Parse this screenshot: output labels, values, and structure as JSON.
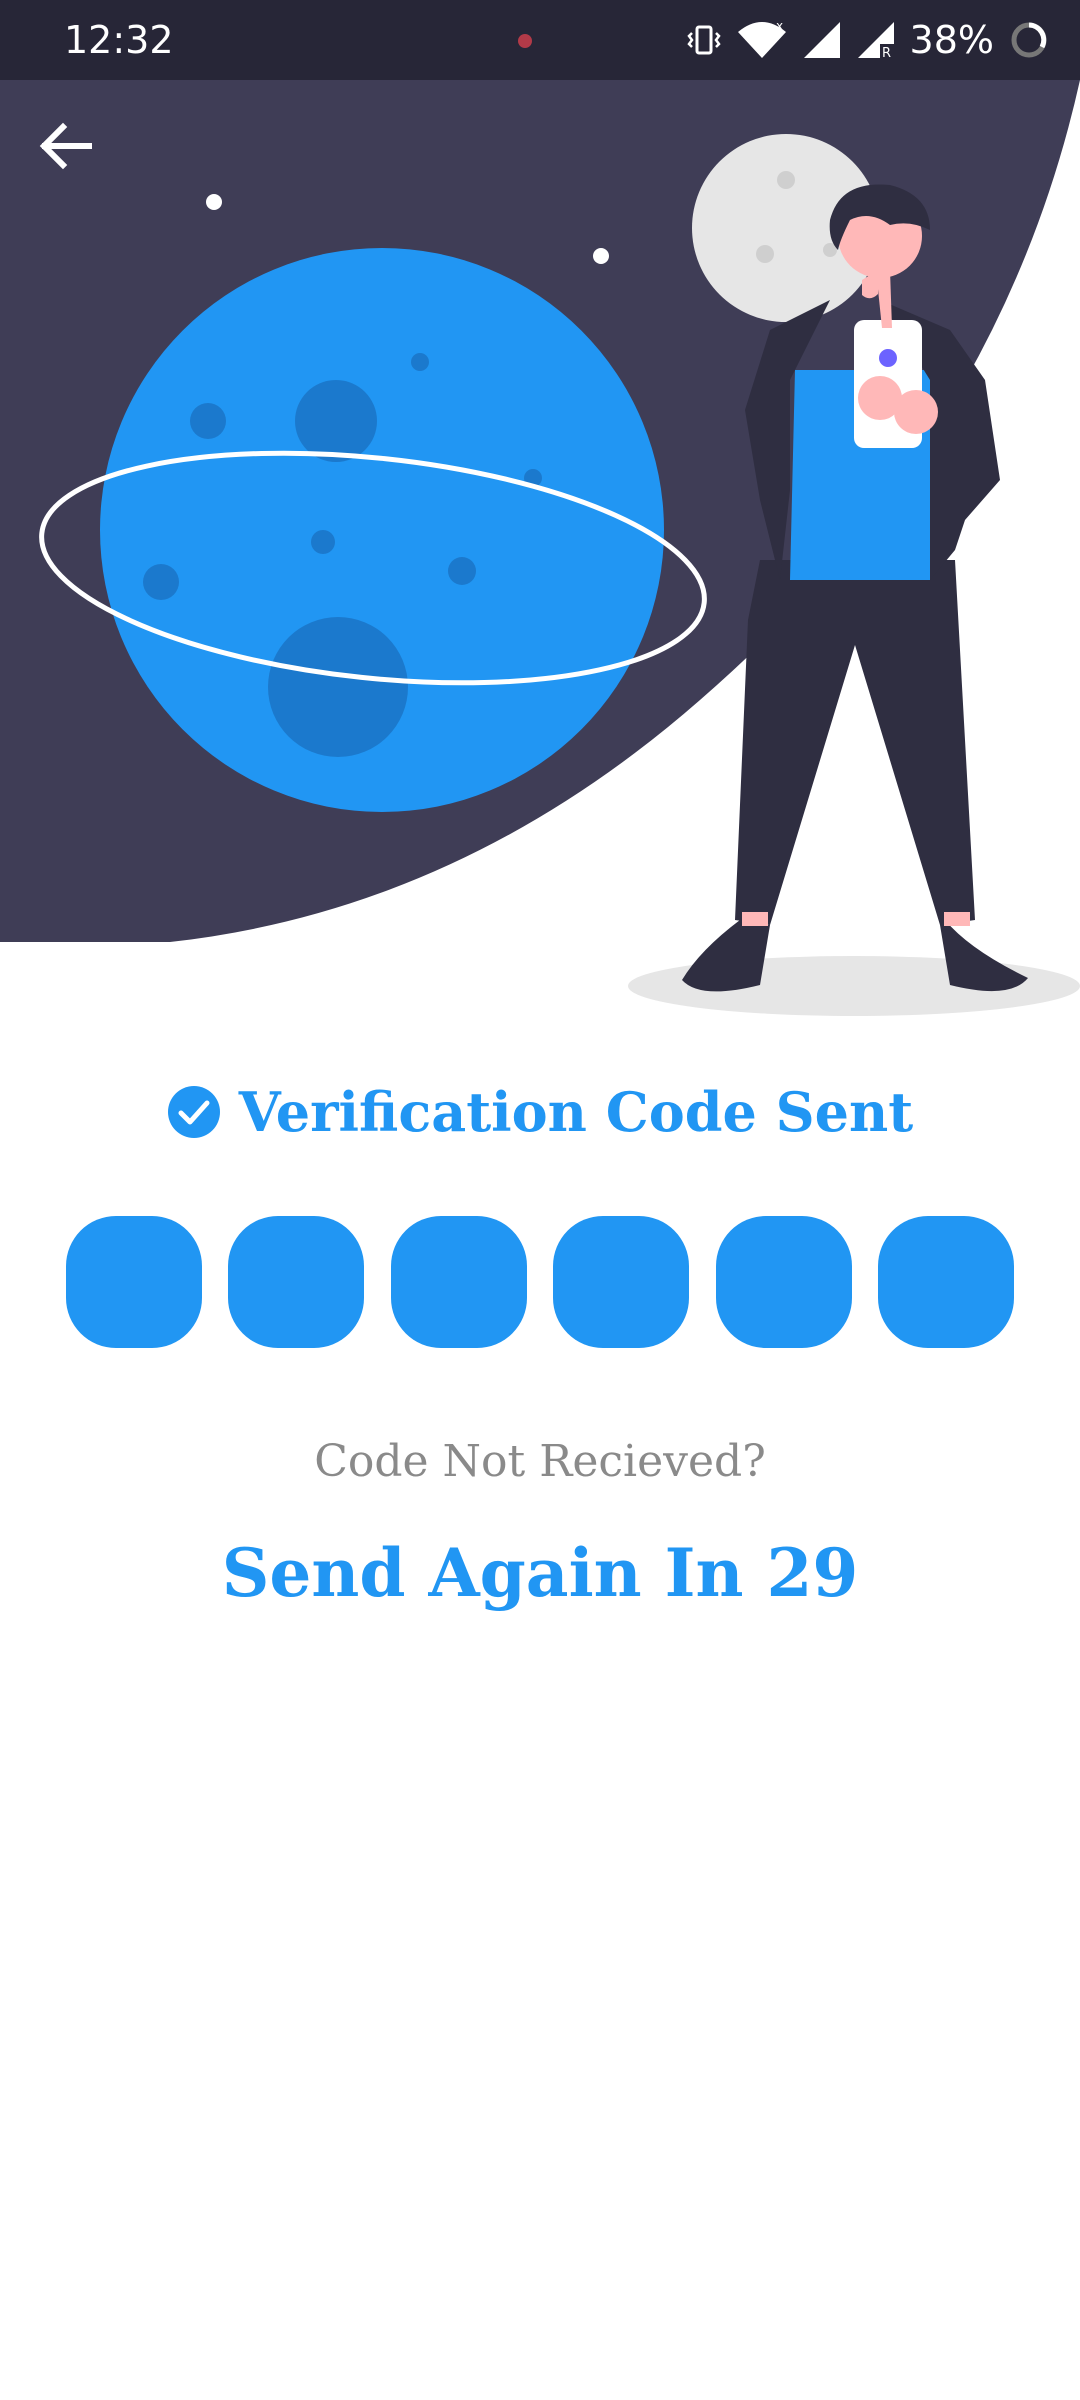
{
  "status_bar": {
    "time": "12:32",
    "battery": "38%",
    "icons": [
      "vibrate-icon",
      "wifi-icon",
      "signal-icon",
      "signal-roaming-icon",
      "battery-saver-icon"
    ]
  },
  "colors": {
    "primary": "#2196f3",
    "dark": "#3f3d56",
    "status_bar": "#272637",
    "muted_text": "#8a8a8a"
  },
  "header": {
    "back_icon": "arrow-left-icon"
  },
  "verification": {
    "title": "Verification Code Sent",
    "icon": "check-circle-icon",
    "code_boxes": [
      {
        "value": ""
      },
      {
        "value": ""
      },
      {
        "value": ""
      },
      {
        "value": ""
      },
      {
        "value": ""
      },
      {
        "value": ""
      }
    ]
  },
  "resend": {
    "prompt": "Code Not Recieved?",
    "action": "Send Again In 29"
  }
}
